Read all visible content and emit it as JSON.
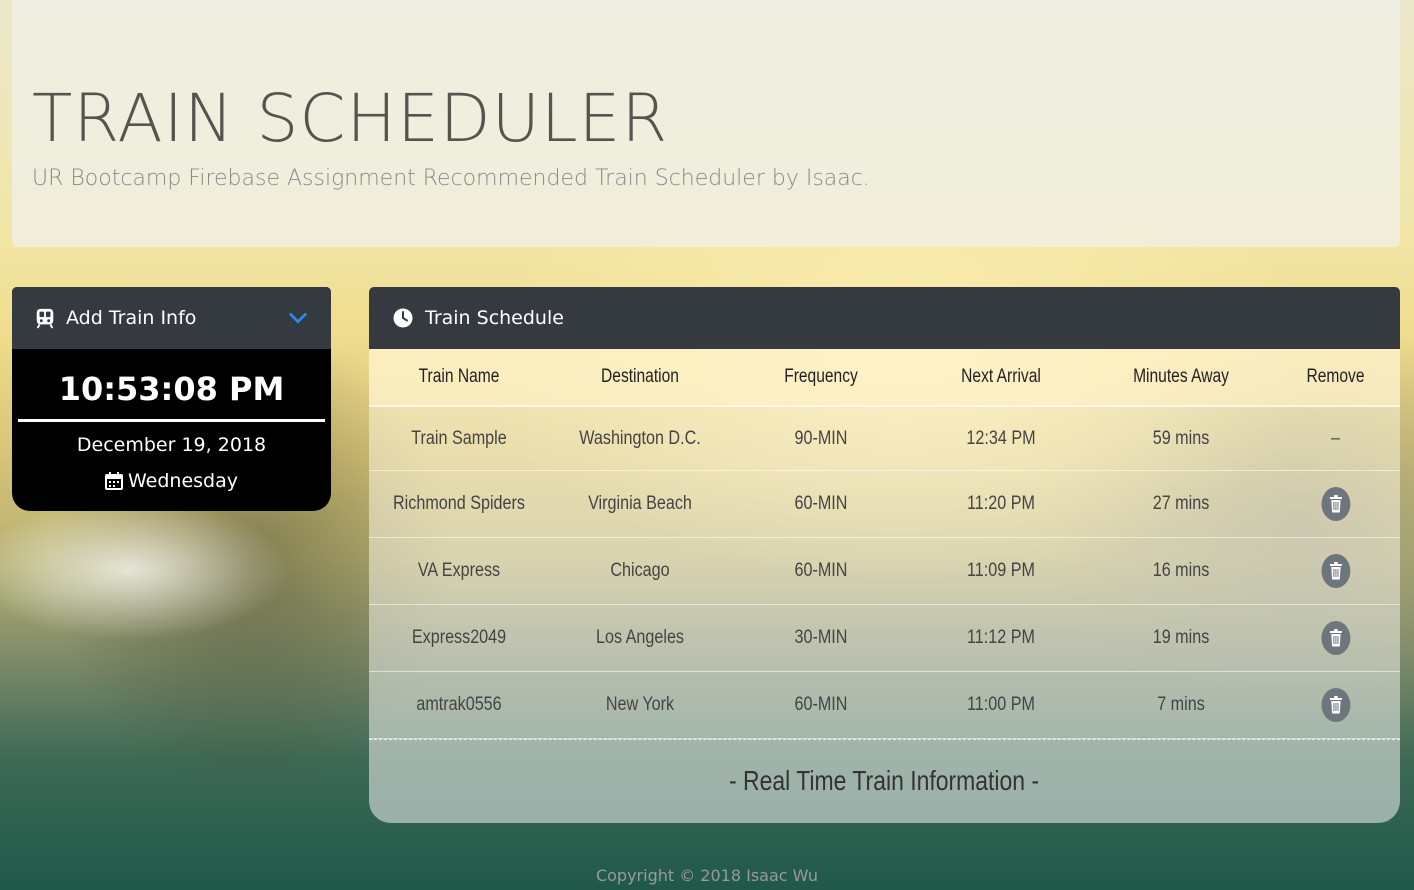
{
  "jumbotron": {
    "title": "TRAIN SCHEDULER",
    "subtitle": "UR Bootcamp Firebase Assignment Recommended Train Scheduler by Isaac."
  },
  "add_card": {
    "header_label": "Add Train Info",
    "icon": "train-icon",
    "toggle_icon": "chevron-down-icon",
    "clock_time": "10:53:08 PM",
    "clock_date": "December 19, 2018",
    "clock_day": "Wednesday",
    "day_icon": "calendar-icon"
  },
  "schedule": {
    "header_label": "Train Schedule",
    "icon": "clock-icon",
    "columns": [
      "Train Name",
      "Destination",
      "Frequency",
      "Next Arrival",
      "Minutes Away",
      "Remove"
    ],
    "rows": [
      {
        "name": "Train Sample",
        "destination": "Washington D.C.",
        "frequency": "90-MIN",
        "next": "12:34 PM",
        "away": "59 mins",
        "remove": "–"
      },
      {
        "name": "Richmond Spiders",
        "destination": "Virginia Beach",
        "frequency": "60-MIN",
        "next": "11:20 PM",
        "away": "27 mins"
      },
      {
        "name": "VA Express",
        "destination": "Chicago",
        "frequency": "60-MIN",
        "next": "11:09 PM",
        "away": "16 mins"
      },
      {
        "name": "Express2049",
        "destination": "Los Angeles",
        "frequency": "30-MIN",
        "next": "11:12 PM",
        "away": "19 mins"
      },
      {
        "name": "amtrak0556",
        "destination": "New York",
        "frequency": "60-MIN",
        "next": "11:00 PM",
        "away": "7 mins"
      }
    ],
    "footer": "- Real Time Train Information -"
  },
  "copyright": "Copyright © 2018 Isaac Wu",
  "colors": {
    "header_bg": "#343a40",
    "chevron": "#2b8bf2",
    "trash_bg": "#6e767d"
  }
}
